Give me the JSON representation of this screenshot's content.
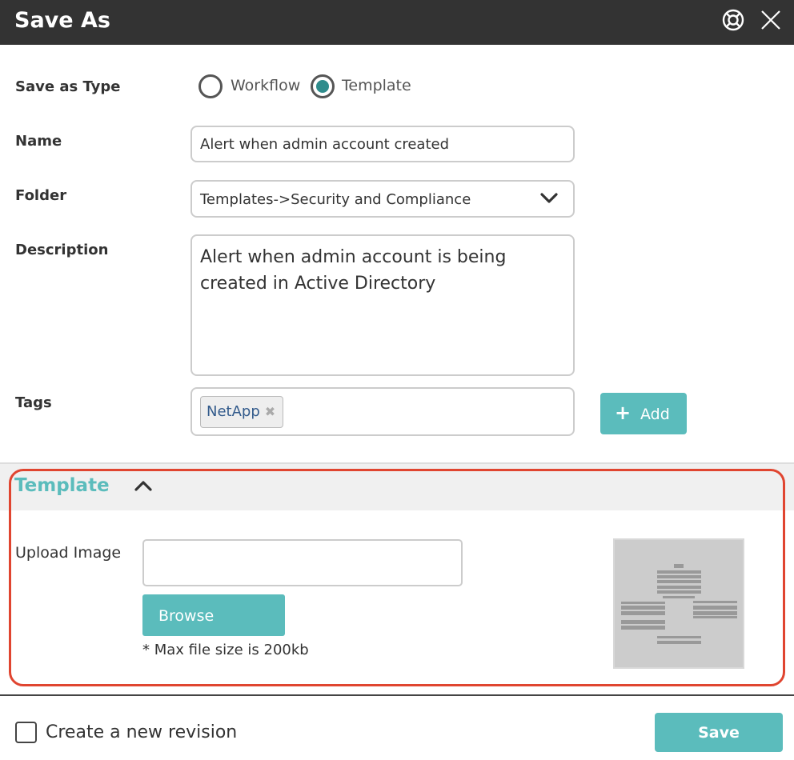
{
  "dialog": {
    "title": "Save As"
  },
  "icons": {
    "help": "lifebuoy-help-icon",
    "close": "close-icon",
    "folder_dropdown": "chevron-down-icon",
    "section_toggle": "chevron-up-icon",
    "tag_remove": "close-x-icon",
    "add": "plus-icon"
  },
  "form": {
    "save_as_type": {
      "label": "Save as Type",
      "options": [
        {
          "label": "Workflow",
          "selected": false
        },
        {
          "label": "Template",
          "selected": true
        }
      ]
    },
    "name": {
      "label": "Name",
      "value": "Alert when admin account created"
    },
    "folder": {
      "label": "Folder",
      "value": "Templates->Security and Compliance"
    },
    "description": {
      "label": "Description",
      "value": "Alert when admin account is being created in Active Directory"
    },
    "tags": {
      "label": "Tags",
      "items": [
        "NetApp"
      ],
      "add_label": "Add"
    }
  },
  "template_section": {
    "title": "Template",
    "expanded": true,
    "upload_label": "Upload Image",
    "upload_value": "",
    "browse_label": "Browse",
    "note": "* Max file size is 200kb"
  },
  "footer": {
    "revision_label": "Create a new revision",
    "revision_checked": false,
    "save_label": "Save"
  },
  "colors": {
    "title_bar": "#333333",
    "accent": "#5bbcbc",
    "radio_selected": "#2f8c8c",
    "highlight": "#e04530",
    "tag_text": "#335b8c"
  }
}
